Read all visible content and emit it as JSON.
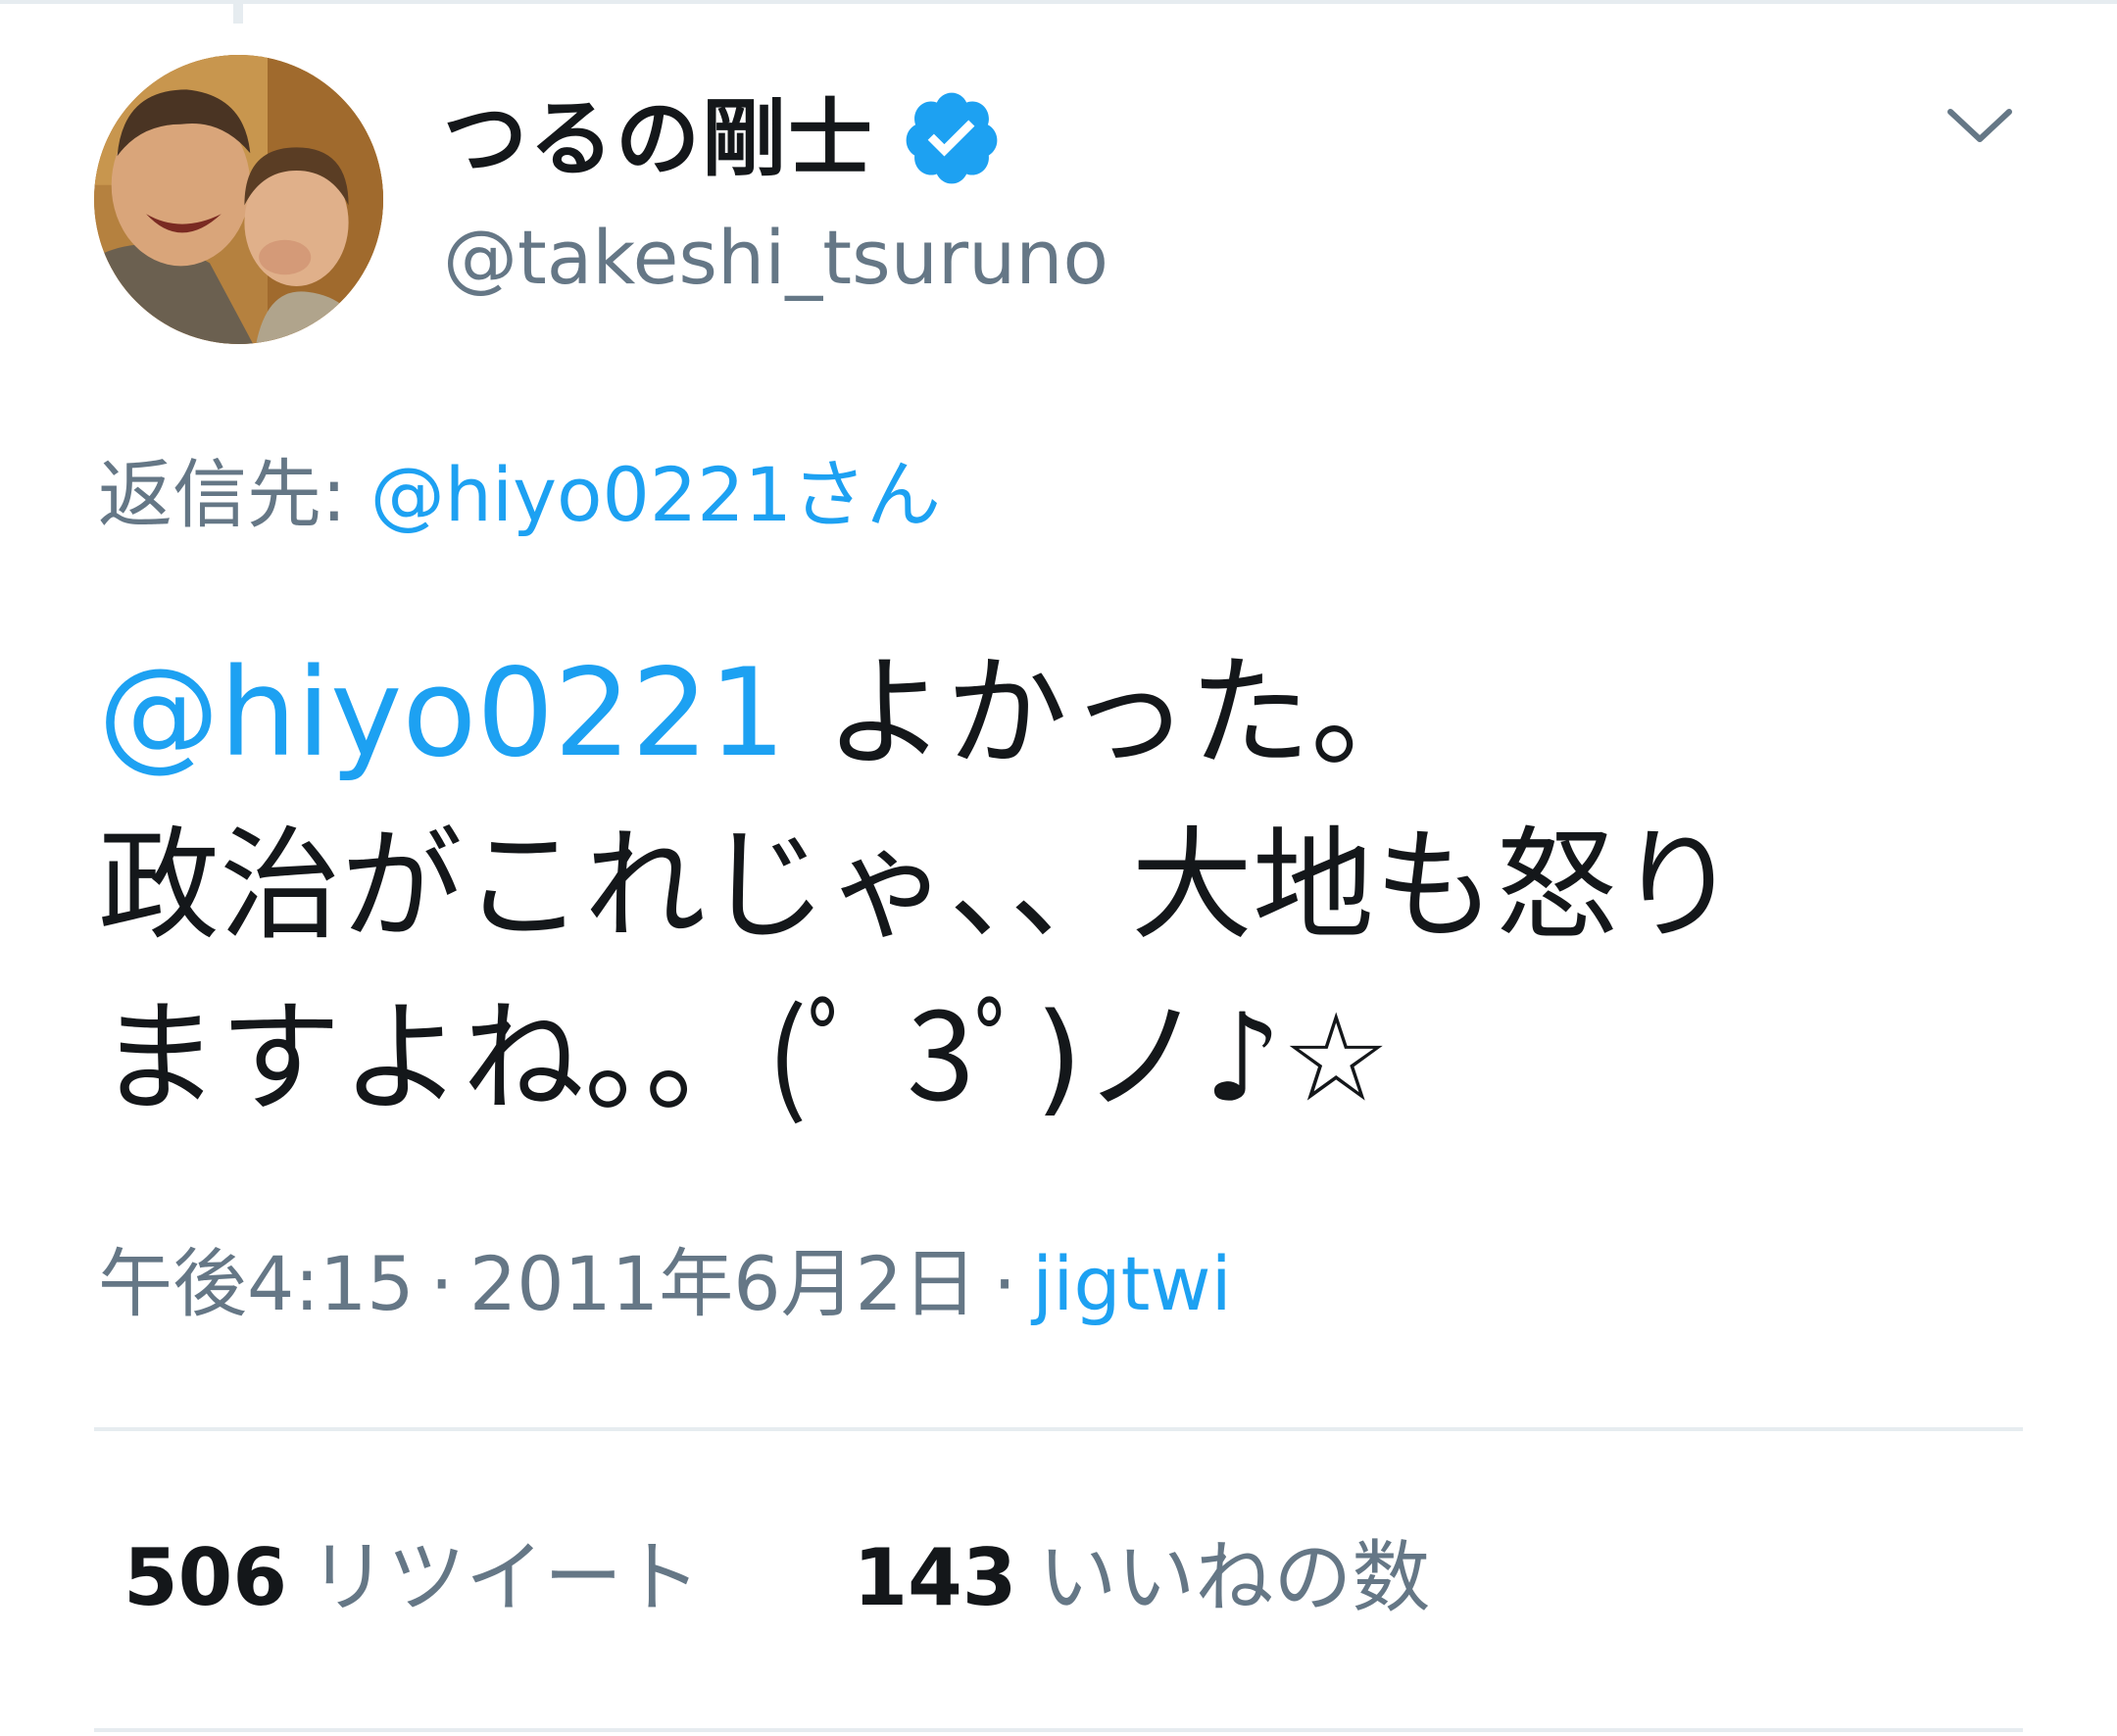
{
  "tweet": {
    "author": {
      "display_name": "つるの剛士",
      "handle": "@takeshi_tsuruno",
      "verified": true,
      "avatar": "avatar-photo"
    },
    "reply_prefix": "返信先:",
    "reply_to": "@hiyo0221",
    "reply_suffix": "さん",
    "text": {
      "mention": "@hiyo0221",
      "line1_rest": " よかった。",
      "line2": "政治がこれじゃ、、大地も怒り",
      "line3": "ますよね。。(ﾟ 3ﾟ)ノ♪☆"
    },
    "meta": {
      "time": "午後4:15",
      "separator": "·",
      "date": "2011年6月2日",
      "source": "jigtwi"
    },
    "stats": {
      "retweets_count": "506",
      "retweets_label": "リツイート",
      "likes_count": "143",
      "likes_label": "いいねの数"
    }
  },
  "icons": {
    "verified": "verified-badge-icon",
    "menu": "chevron-down-icon"
  },
  "colors": {
    "accent": "#1da1f2",
    "secondary_text": "#657786",
    "primary_text": "#14171a",
    "divider": "#e6ecf0"
  }
}
